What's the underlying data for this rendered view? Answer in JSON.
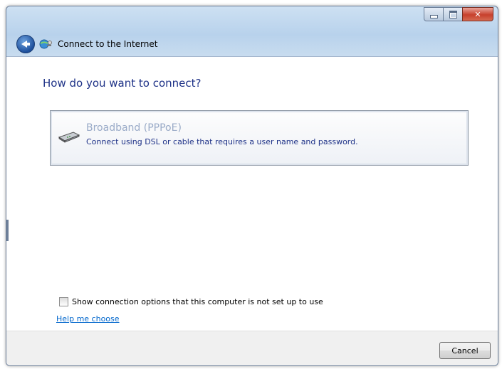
{
  "window": {
    "title": "Connect to the Internet",
    "caption_buttons": [
      "minimize",
      "maximize",
      "close"
    ]
  },
  "main": {
    "heading": "How do you want to connect?",
    "option": {
      "title": "Broadband (PPPoE)",
      "description": "Connect using DSL or cable that requires a user name and password.",
      "icon": "broadband-modem-icon"
    },
    "show_options_label": "Show connection options that this computer is not set up to use",
    "help_link": "Help me choose"
  },
  "footer": {
    "cancel_label": "Cancel"
  },
  "colors": {
    "heading": "#1e3287",
    "link": "#0066cc",
    "option_title_disabled": "#9aabc8",
    "close_button": "#c7402c"
  }
}
